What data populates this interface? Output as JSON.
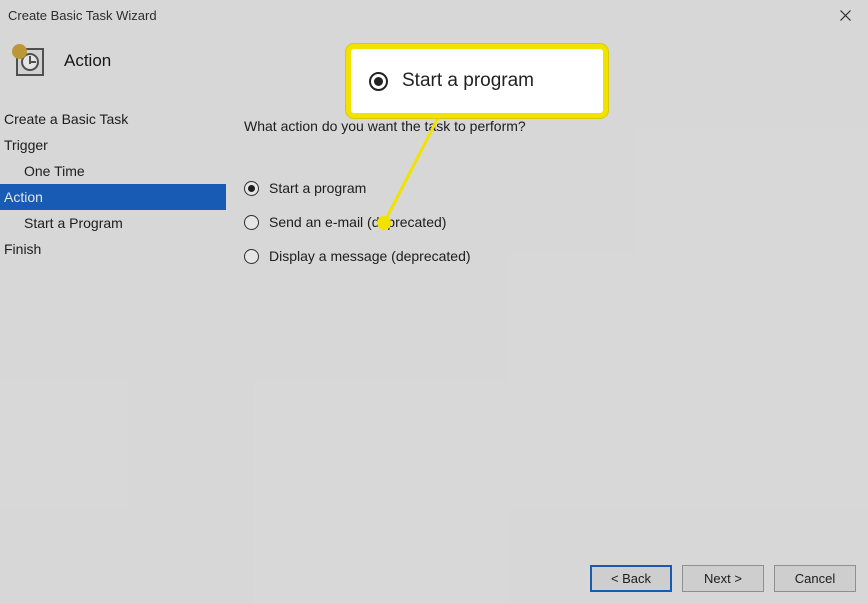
{
  "window": {
    "title": "Create Basic Task Wizard"
  },
  "header": {
    "page_title": "Action"
  },
  "sidebar": {
    "step_create": "Create a Basic Task",
    "step_trigger": "Trigger",
    "step_trigger_sub": "One Time",
    "step_action": "Action",
    "step_action_sub": "Start a Program",
    "step_finish": "Finish"
  },
  "main": {
    "prompt": "What action do you want the task to perform?",
    "options": {
      "start_program": "Start a program",
      "send_email": "Send an e-mail (deprecated)",
      "display_message": "Display a message (deprecated)"
    },
    "selected": "start_program"
  },
  "footer": {
    "back": "< Back",
    "next": "Next >",
    "cancel": "Cancel"
  },
  "callout": {
    "label": "Start a program"
  }
}
